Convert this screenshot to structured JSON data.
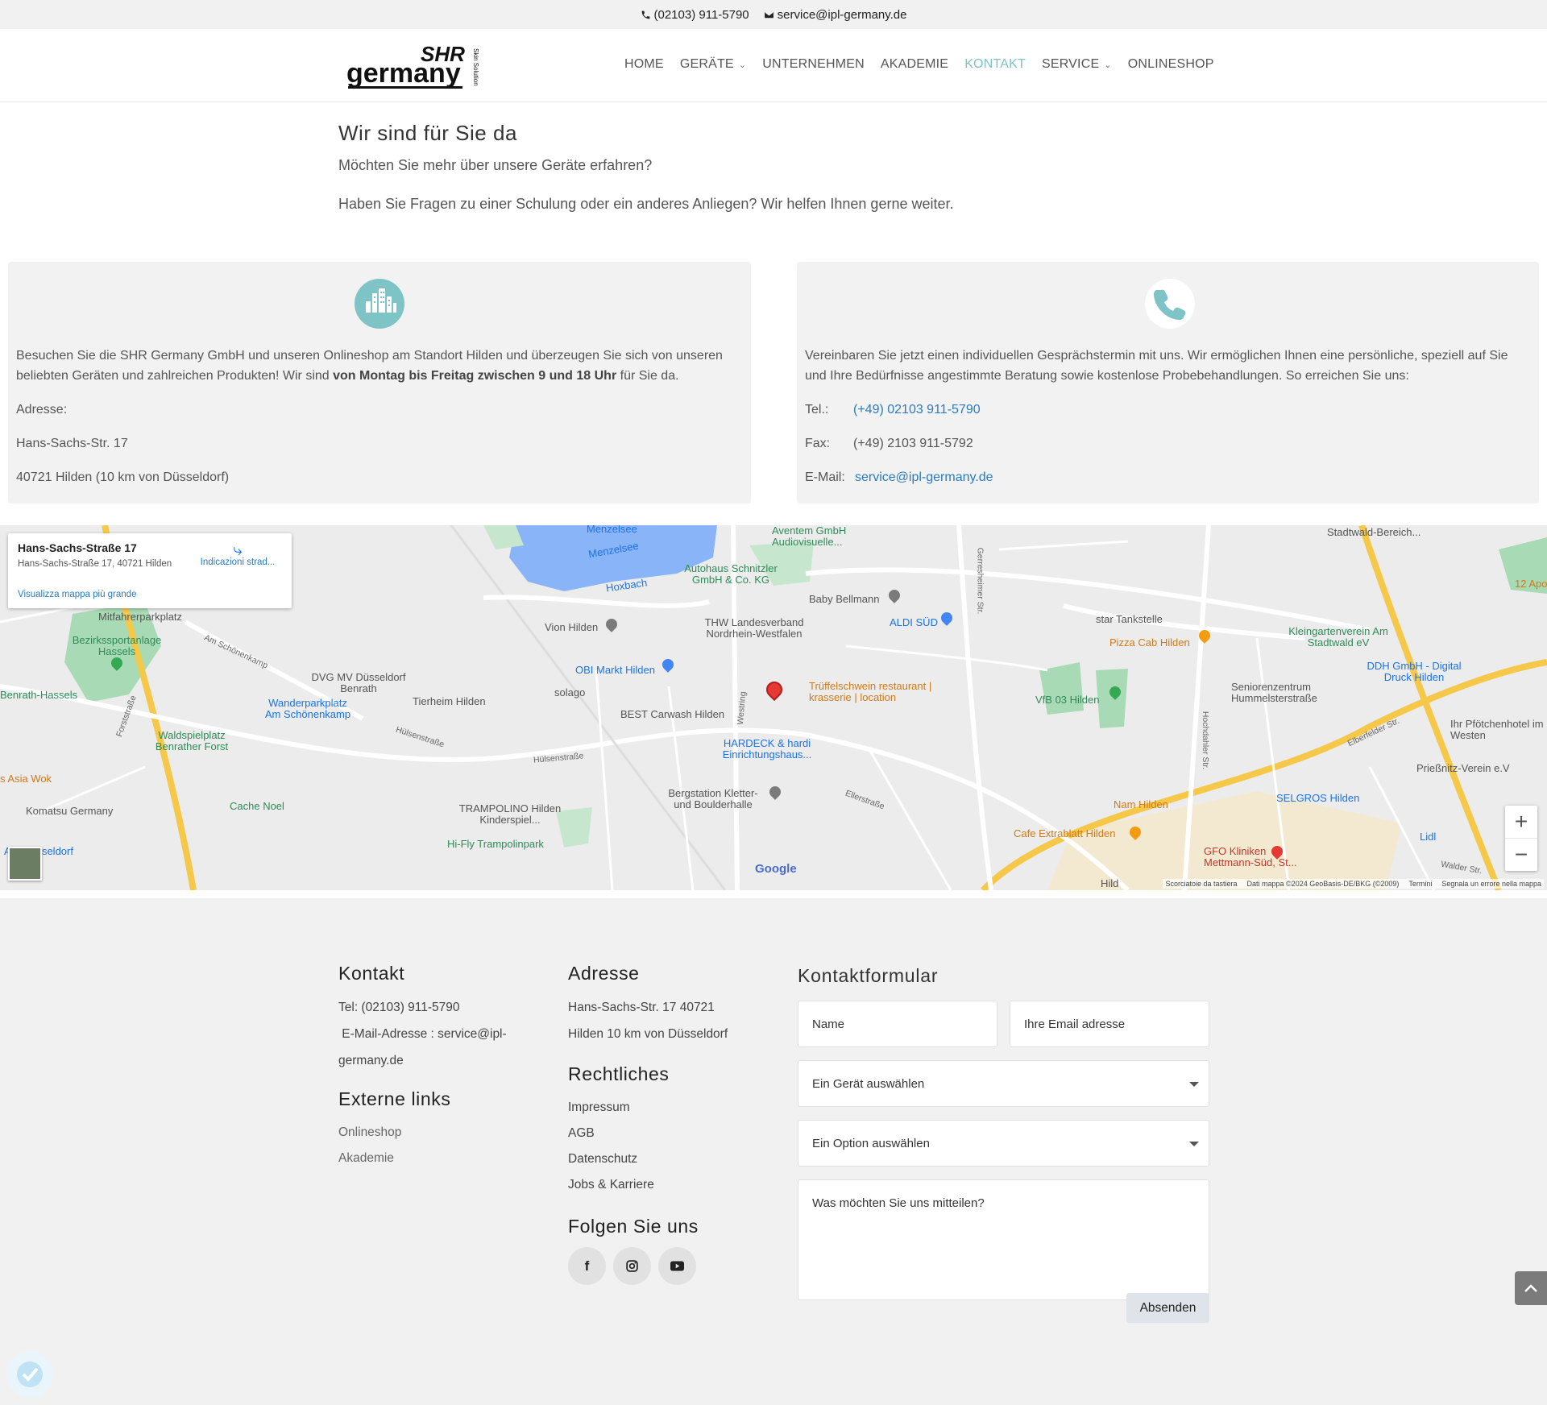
{
  "topbar": {
    "phone": "(02103) 911-5790",
    "email": "service@ipl-germany.de"
  },
  "logo": {
    "line1": "SHR",
    "line2": "germany",
    "tagline": "Skin Solution"
  },
  "nav": [
    {
      "label": "HOME",
      "dropdown": false,
      "active": false
    },
    {
      "label": "GERÄTE",
      "dropdown": true,
      "active": false
    },
    {
      "label": "UNTERNEHMEN",
      "dropdown": false,
      "active": false
    },
    {
      "label": "AKADEMIE",
      "dropdown": false,
      "active": false
    },
    {
      "label": "KONTAKT",
      "dropdown": false,
      "active": true
    },
    {
      "label": "SERVICE",
      "dropdown": true,
      "active": false
    },
    {
      "label": "ONLINESHOP",
      "dropdown": false,
      "active": false
    }
  ],
  "intro": {
    "title": "Wir sind für Sie da",
    "line1": "Möchten Sie mehr über unsere Geräte erfahren?",
    "line2": "Haben Sie Fragen zu einer Schulung oder ein anderes Anliegen? Wir helfen Ihnen gerne weiter."
  },
  "visit": {
    "text_a": "Besuchen Sie die SHR Germany GmbH und unseren Onlineshop am Standort Hilden und überzeugen Sie sich von unseren beliebten Geräten und zahlreichen Produkten! Wir sind ",
    "text_bold": "von Montag bis Freitag zwischen 9 und 18 Uhr",
    "text_b": " für Sie da.",
    "address_label": "Adresse:",
    "street": "Hans-Sachs-Str. 17",
    "city": "40721 Hilden (10 km von Düsseldorf)"
  },
  "call": {
    "text": "Vereinbaren Sie jetzt einen individuellen Gesprächstermin mit uns. Wir ermöglichen Ihnen eine persönliche, speziell auf Sie und Ihre Bedürfnisse angestimmte Beratung sowie kostenlose Probebehandlungen. So erreichen Sie uns:",
    "tel_label": "Tel.:",
    "tel": "(+49) 02103 911-5790",
    "fax_label": "Fax:",
    "fax": "(+49) 2103 911-5792",
    "email_label": "E-Mail:",
    "email": "service@ipl-germany.de"
  },
  "map": {
    "card_title": "Hans-Sachs-Straße 17",
    "card_address": "Hans-Sachs-Straße 17, 40721 Hilden",
    "card_directions": "Indicazioni strad...",
    "card_bigger": "Visualizza mappa più grande",
    "labels": [
      "Menzelsee",
      "Menzelsee",
      "Hoxbach",
      "Aventem GmbH Audiovisuelle...",
      "Autohaus Schnitzler GmbH & Co. KG",
      "Baby Bellmann",
      "Vion Hilden",
      "THW Landesverband Nordrhein-Westfalen",
      "ALDI SÜD",
      "star Tankstelle",
      "Pizza Cab Hilden",
      "Kleingartenverein Am Stadtwald eV",
      "DDH GmbH - Digital Druck Hilden",
      "Stadtwald-Bereich...",
      "12 Apo",
      "Mitfahrerparkplatz",
      "Bezirkssportanlage Hassels",
      "Benrath-Hassels",
      "DVG MV Düsseldorf Benrath",
      "Wanderparkplatz Am Schönenkamp",
      "Tierheim Hilden",
      "solago",
      "OBI Markt Hilden",
      "Trüffelschwein restaurant | krasserie | location",
      "BEST Carwash Hilden",
      "HARDECK & hardi Einrichtungshaus...",
      "VfB 03 Hilden",
      "Seniorenzentrum Hummelsterstraße",
      "Ihr Pfötchenhotel im Westen",
      "Prießnitz-Verein e.V",
      "Waldspielplatz Benrather Forst",
      "s Asia Wok",
      "Komatsu Germany",
      "Cache Noel",
      "TRAMPOLINO Hilden Kinderspiel...",
      "Hi-Fly Trampolinpark",
      "Bergstation Kletter- und Boulderhalle",
      "Nam Hilden",
      "SELGROS Hilden",
      "Cafe Extrablatt Hilden",
      "GFO Kliniken Mettmann-Süd, St...",
      "Lidl",
      "ASTER seldorf",
      "Hild"
    ],
    "roads": [
      "Am Schönenkamp",
      "Hülsenstraße",
      "Hülsenstraße",
      "Westring",
      "Gerresheimer Str.",
      "Hochdahler Str.",
      "Elberfelder Str.",
      "Ellerstraße",
      "Forststraße",
      "Walder Str."
    ],
    "attrib": [
      "Scorciatoie da tastiera",
      "Dati mappa ©2024 GeoBasis-DE/BKG (©2009)",
      "Termini",
      "Segnala un errore nella mappa"
    ],
    "google": "Google",
    "zoom_in": "+",
    "zoom_out": "−"
  },
  "footer": {
    "kontakt_title": "Kontakt",
    "kontakt_tel": "Tel: (02103) 911-5790",
    "kontakt_email_a": " E-Mail-Adresse : service@ipl-",
    "kontakt_email_b": "germany.de",
    "extern_title": "Externe links",
    "extern_links": [
      "Onlineshop",
      "Akademie"
    ],
    "adresse_title": "Adresse",
    "adresse_a": "Hans-Sachs-Str. 17 40721",
    "adresse_b": "Hilden 10 km von Düsseldorf",
    "recht_title": "Rechtliches",
    "recht_links": [
      "Impressum",
      "AGB",
      "Datenschutz",
      "Jobs & Karriere"
    ],
    "folgen_title": "Folgen Sie uns",
    "social": [
      "facebook-icon",
      "instagram-icon",
      "youtube-icon"
    ]
  },
  "form": {
    "title": "Kontaktformular",
    "name_placeholder": "Name",
    "email_placeholder": "Ihre Email adresse",
    "device_select": "Ein Gerät auswählen",
    "option_select": "Ein Option auswählen",
    "message_placeholder": "Was möchten Sie uns mitteilen?",
    "submit": "Absenden"
  },
  "colors": {
    "accent": "#7ec3c6",
    "link": "#2a7bbf",
    "footer_bg": "#f1f1f1",
    "box_bg": "#f2f2f2"
  }
}
